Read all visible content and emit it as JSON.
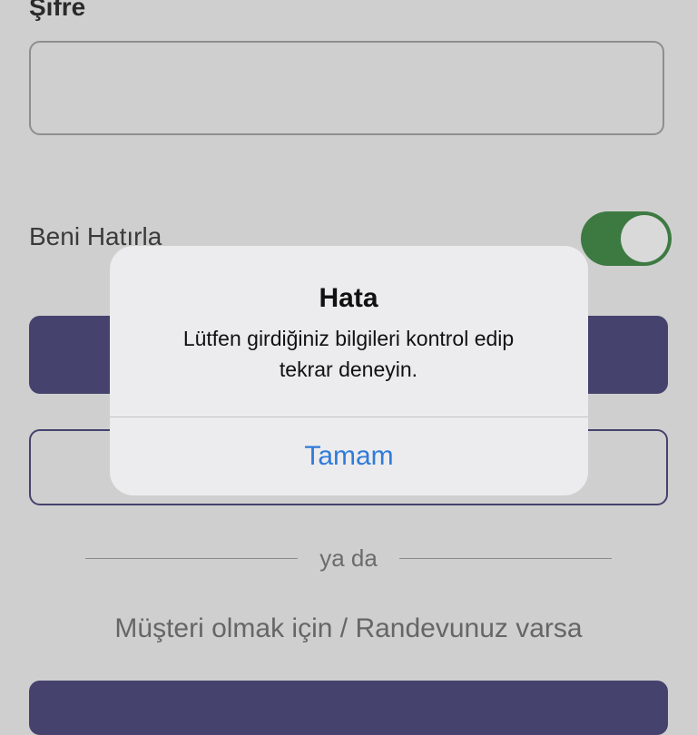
{
  "form": {
    "password_label": "Şifre",
    "password_value": "",
    "remember_label": "Beni Hatırla",
    "remember_on": true
  },
  "divider": {
    "text": "ya da"
  },
  "signup": {
    "text": "Müşteri olmak için / Randevunuz varsa"
  },
  "alert": {
    "title": "Hata",
    "message_line1": "Lütfen girdiğiniz bilgileri kontrol edip",
    "message_line2": "tekrar deneyin.",
    "button": "Tamam"
  },
  "colors": {
    "primary": "#45426e",
    "toggle_on": "#3d7a42",
    "alert_button": "#2f7bd8"
  }
}
